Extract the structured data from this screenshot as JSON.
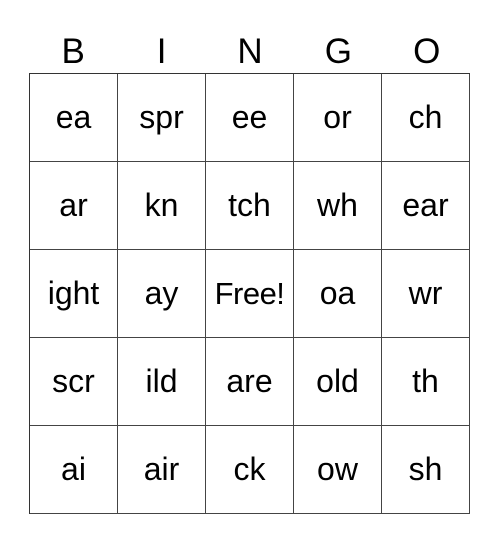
{
  "header": [
    "B",
    "I",
    "N",
    "G",
    "O"
  ],
  "rows": [
    [
      "ea",
      "spr",
      "ee",
      "or",
      "ch"
    ],
    [
      "ar",
      "kn",
      "tch",
      "wh",
      "ear"
    ],
    [
      "ight",
      "ay",
      "Free!",
      "oa",
      "wr"
    ],
    [
      "scr",
      "ild",
      "are",
      "old",
      "th"
    ],
    [
      "ai",
      "air",
      "ck",
      "ow",
      "sh"
    ]
  ],
  "free_space": {
    "row": 2,
    "col": 2
  }
}
